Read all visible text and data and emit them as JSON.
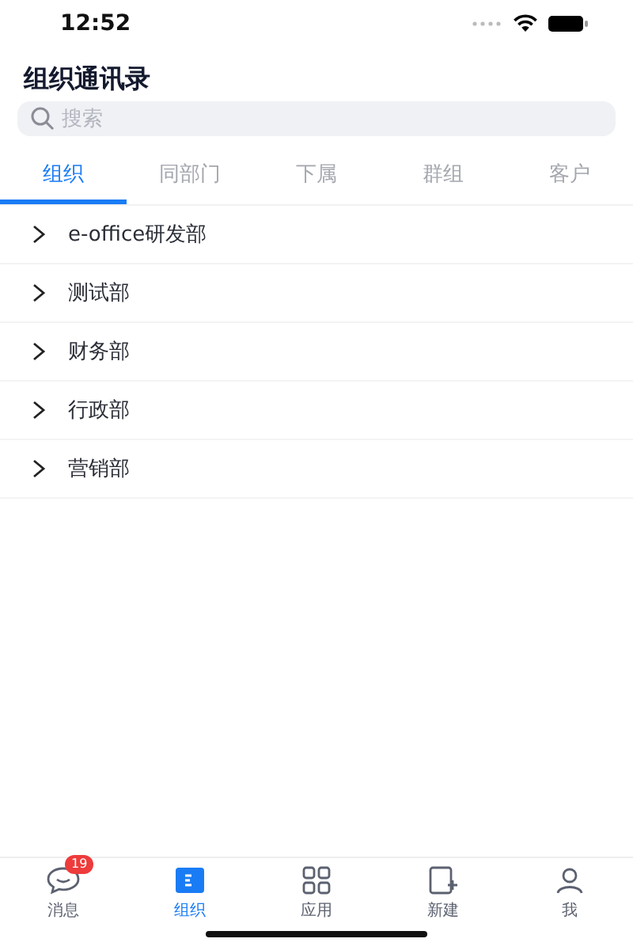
{
  "status_bar": {
    "time": "12:52"
  },
  "title": "组织通讯录",
  "search": {
    "placeholder": "搜索"
  },
  "tabs": [
    {
      "label": "组织",
      "selected": true
    },
    {
      "label": "同部门",
      "selected": false
    },
    {
      "label": "下属",
      "selected": false
    },
    {
      "label": "群组",
      "selected": false
    },
    {
      "label": "客户",
      "selected": false
    }
  ],
  "departments": [
    {
      "name": "e-office研发部",
      "expanded": false
    },
    {
      "name": "测试部",
      "expanded": false
    },
    {
      "name": "财务部",
      "expanded": false
    },
    {
      "name": "行政部",
      "expanded": false
    },
    {
      "name": "营销部",
      "expanded": false
    }
  ],
  "tab_bar": [
    {
      "kind": "chat",
      "label": "消息",
      "badge": "19",
      "selected": false
    },
    {
      "kind": "org",
      "label": "组织",
      "selected": true
    },
    {
      "kind": "apps",
      "label": "应用",
      "selected": false
    },
    {
      "kind": "new",
      "label": "新建",
      "selected": false
    },
    {
      "kind": "me",
      "label": "我",
      "selected": false
    }
  ]
}
